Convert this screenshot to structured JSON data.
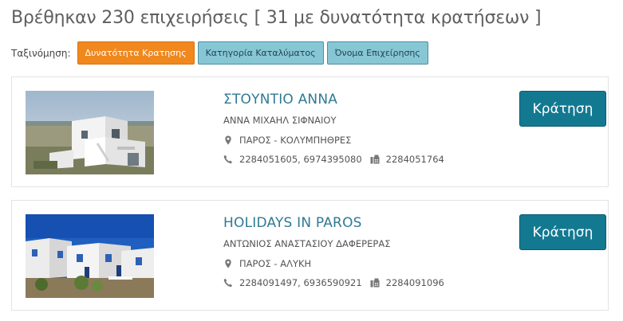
{
  "header": {
    "results_title": "Βρέθηκαν 230 επιχειρήσεις [ 31 με δυνατότητα κρατήσεων ]"
  },
  "sort": {
    "label": "Ταξινόμηση:",
    "options": [
      {
        "label": "Δυνατότητα Κρατησης",
        "active": true
      },
      {
        "label": "Κατηγορία Καταλύματος",
        "active": false
      },
      {
        "label": "Όνομα Επιχείρησης",
        "active": false
      }
    ]
  },
  "listings": [
    {
      "name": "ΣΤΟΥΝΤΙΟ ΑΝΝΑ",
      "owner": "ΑΝΝΑ ΜΙΧΑΗΛ ΣΙΦΝΑΙΟΥ",
      "location": "ΠΑΡΟΣ - ΚΟΛΥΜΠΗΘΡΕΣ",
      "phones": "2284051605, 6974395080",
      "fax": "2284051764",
      "book_label": "Κράτηση"
    },
    {
      "name": "HOLIDAYS IN PAROS",
      "owner": "ΑΝΤΩΝΙΟΣ ΑΝΑΣΤΑΣΙΟΥ ΔΑΦΕΡΕΡΑΣ",
      "location": "ΠΑΡΟΣ - ΑΛΥΚΗ",
      "phones": "2284091497, 6936590921",
      "fax": "2284091096",
      "book_label": "Κράτηση"
    }
  ],
  "icons": {
    "location": "map-marker-icon",
    "phone": "phone-icon",
    "fax": "fax-icon"
  },
  "colors": {
    "active_sort": "#f0881e",
    "inactive_sort": "#87c6d5",
    "link": "#2f7a93",
    "book_button": "#137991"
  }
}
